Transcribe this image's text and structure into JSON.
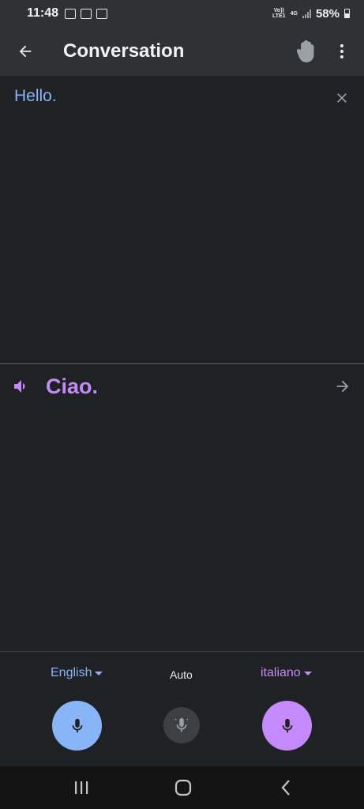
{
  "status_bar": {
    "time": "11:48",
    "network_top": "Vo))",
    "network_bottom": "LTE1",
    "network_type": "4G",
    "battery": "58%"
  },
  "app_bar": {
    "title": "Conversation",
    "back_icon": "arrow-back-icon",
    "hand_icon": "hand-icon",
    "menu_icon": "more-vert-icon"
  },
  "source": {
    "text": "Hello."
  },
  "target": {
    "text": "Ciao."
  },
  "languages": {
    "left": "English",
    "middle": "Auto",
    "right": "italiano"
  },
  "colors": {
    "background": "#202124",
    "bar": "#303134",
    "source_accent": "#8ab4f8",
    "target_accent": "#c58af9"
  }
}
